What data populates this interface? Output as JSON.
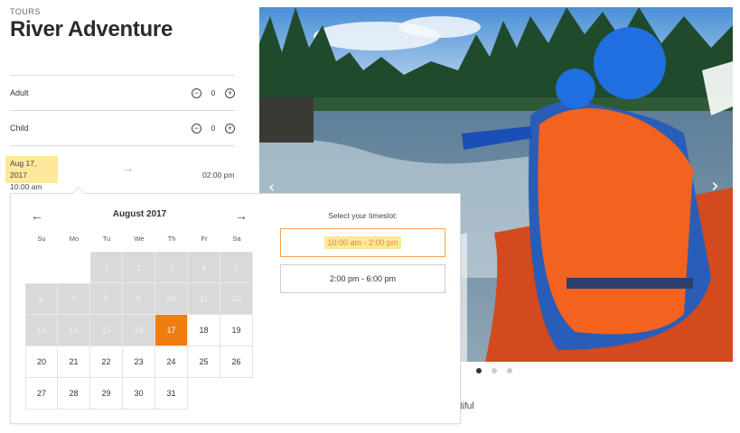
{
  "header": {
    "category": "TOURS",
    "title": "River Adventure"
  },
  "quantities": [
    {
      "label": "Adult",
      "value": "0"
    },
    {
      "label": "Child",
      "value": "0"
    }
  ],
  "booking": {
    "start_date": "Aug 17, 2017",
    "start_time": "10:00 am",
    "end_time": "02:00 pm",
    "arrow": "→"
  },
  "calendar": {
    "month_title": "August 2017",
    "prev": "←",
    "next": "→",
    "weekdays": [
      "Su",
      "Mo",
      "Tu",
      "We",
      "Th",
      "Fr",
      "Sa"
    ],
    "weeks": [
      [
        "",
        "",
        "1",
        "2",
        "3",
        "4",
        "5"
      ],
      [
        "6",
        "7",
        "8",
        "9",
        "10",
        "11",
        "12"
      ],
      [
        "13",
        "14",
        "15",
        "16",
        "17",
        "18",
        "19"
      ],
      [
        "20",
        "21",
        "22",
        "23",
        "24",
        "25",
        "26"
      ],
      [
        "27",
        "28",
        "29",
        "30",
        "31",
        "",
        ""
      ]
    ],
    "selected_day": "17",
    "first_available_day": 17
  },
  "timeslots": {
    "label": "Select your timeslot:",
    "slots": [
      "10:00 am - 2:00 pm",
      "2:00 pm - 6:00 pm"
    ],
    "selected_index": 0
  },
  "gallery": {
    "image": "river-rafting-photo",
    "prev_icon": "‹",
    "next_icon": "›",
    "slide_count": 3,
    "active_slide": 0,
    "caption_fragment": "tiful"
  },
  "colors": {
    "accent": "#f07d0f",
    "highlight": "#fde89b",
    "disabled": "#d9d9d9"
  }
}
